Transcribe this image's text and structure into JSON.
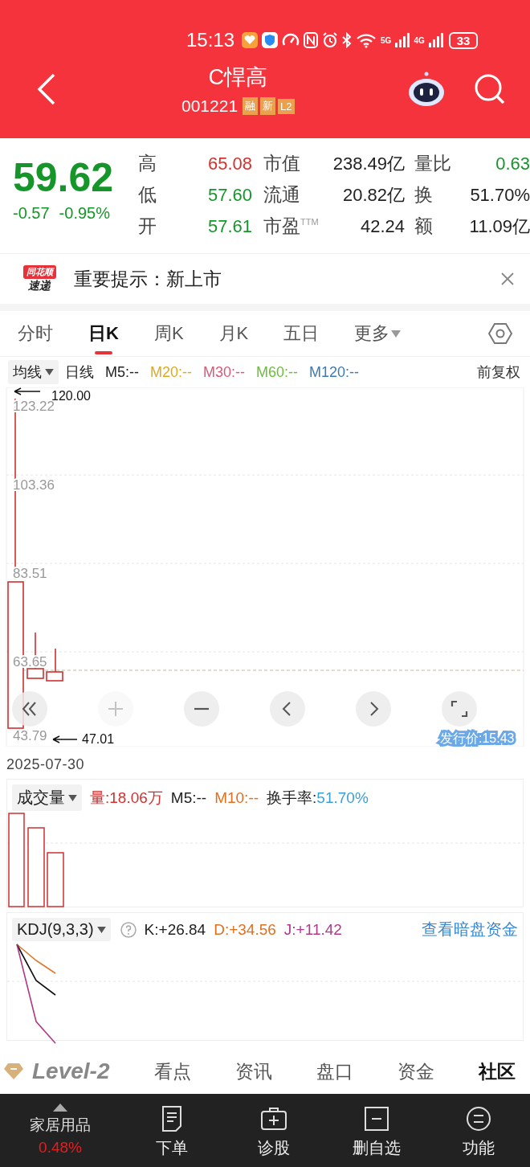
{
  "status_bar": {
    "time": "15:13",
    "signal_1": "5G",
    "signal_2": "4G",
    "battery": "33"
  },
  "header": {
    "title": "C悍高",
    "code": "001221",
    "badges": [
      "融",
      "新",
      "L2"
    ]
  },
  "quote": {
    "price": "59.62",
    "change": "-0.57",
    "change_pct": "-0.95%",
    "color": "#16962a",
    "stats": [
      [
        {
          "label": "高",
          "value": "65.08",
          "color": "#d8302c"
        },
        {
          "label": "市值",
          "value": "238.49亿",
          "color": "#222222"
        },
        {
          "label": "量比",
          "value": "0.63",
          "color": "#16962a"
        }
      ],
      [
        {
          "label": "低",
          "value": "57.60",
          "color": "#16962a"
        },
        {
          "label": "流通",
          "value": "20.82亿",
          "color": "#222222"
        },
        {
          "label": "换",
          "value": "51.70%",
          "color": "#222222"
        }
      ],
      [
        {
          "label": "开",
          "value": "57.61",
          "color": "#16962a"
        },
        {
          "label": "市盈$^{TTM}$",
          "value": "42.24",
          "color": "#222222"
        },
        {
          "label": "额",
          "value": "11.09亿",
          "color": "#222222"
        }
      ]
    ]
  },
  "notice": {
    "brand_top": "同花顺",
    "brand_bottom": "速递",
    "text": "重要提示：新上市"
  },
  "period_tabs": [
    {
      "label": "分时",
      "selected": false,
      "kind": "tab"
    },
    {
      "label": "日K",
      "selected": true,
      "kind": "tab"
    },
    {
      "label": "周K",
      "selected": false,
      "kind": "tab"
    },
    {
      "label": "月K",
      "selected": false,
      "kind": "tab"
    },
    {
      "label": "五日",
      "selected": false,
      "kind": "tab"
    },
    {
      "label": "更多",
      "selected": false,
      "kind": "menu"
    }
  ],
  "ma_bar": {
    "selector": "均线",
    "period": "日线",
    "lines": [
      {
        "label": "M5:--",
        "color": "#222222"
      },
      {
        "label": "M20:--",
        "color": "#e0a820"
      },
      {
        "label": "M30:--",
        "color": "#d85a78"
      },
      {
        "label": "M60:--",
        "color": "#6cbc3c"
      },
      {
        "label": "M120:--",
        "color": "#3a7ab8"
      }
    ],
    "adjust": "前复权"
  },
  "kline": {
    "axis_labels": [
      "123.22",
      "103.36",
      "83.51",
      "63.65",
      "43.79"
    ],
    "max_marker": "120.00",
    "min_marker": "47.01",
    "issue_price": "发行价:15.43",
    "date": "2025-07-30",
    "controls": [
      {
        "disabled": false
      },
      {
        "disabled": true
      },
      {
        "disabled": false
      },
      {
        "disabled": false
      },
      {
        "disabled": false
      },
      {
        "disabled": false
      }
    ]
  },
  "volume": {
    "selector": "成交量",
    "items": [
      {
        "text": "量:18.06万",
        "color": "#d03030"
      },
      {
        "text": "M5:--",
        "color": "#222222"
      },
      {
        "text": "M10:--",
        "color": "#e07020"
      },
      {
        "text": "换手率:",
        "color": "#222222"
      },
      {
        "text": "51.70%",
        "color": "#3aa0d8"
      }
    ]
  },
  "kdj": {
    "selector": "KDJ(9,3,3)",
    "items": [
      {
        "text": "K:+26.84",
        "color": "#222222"
      },
      {
        "text": "D:+34.56",
        "color": "#e07020"
      },
      {
        "text": "J:+11.42",
        "color": "#b03a8a"
      }
    ],
    "link": "查看暗盘资金"
  },
  "bottom_tabs": [
    {
      "label": "Level-2",
      "kind": "brand",
      "selected": false
    },
    {
      "label": "看点",
      "kind": "tab",
      "selected": false
    },
    {
      "label": "资讯",
      "kind": "tab",
      "selected": false
    },
    {
      "label": "盘口",
      "kind": "tab",
      "selected": false
    },
    {
      "label": "资金",
      "kind": "tab",
      "selected": false
    },
    {
      "label": "社区",
      "kind": "tab",
      "selected": true
    }
  ],
  "bottom_nav": {
    "sector": {
      "name": "家居用品",
      "change": "0.48%",
      "color": "#e02020"
    },
    "items": [
      {
        "label": "下单"
      },
      {
        "label": "诊股"
      },
      {
        "label": "删自选"
      },
      {
        "label": "功能"
      }
    ]
  }
}
